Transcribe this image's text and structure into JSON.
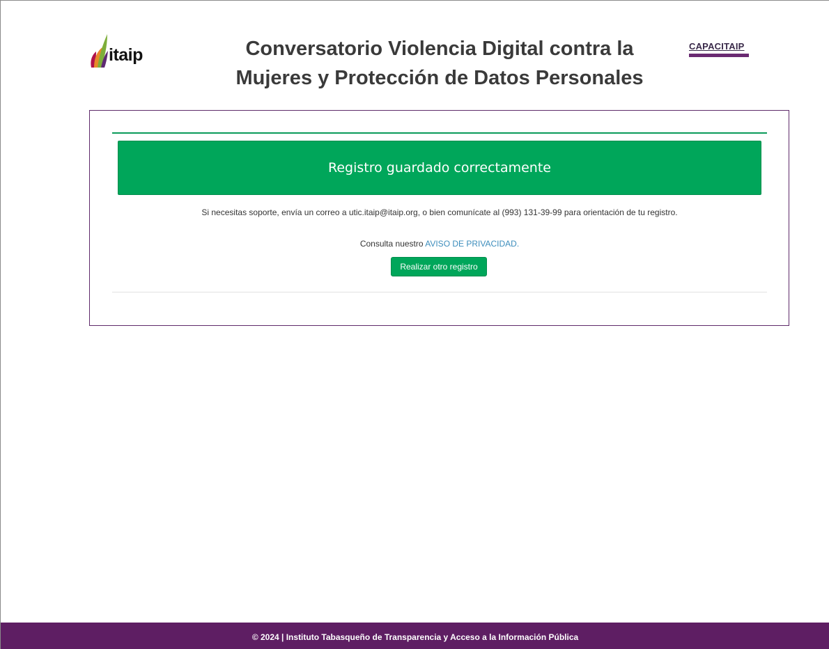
{
  "header": {
    "logo_left_text": "itaip",
    "title_line1": "Conversatorio Violencia Digital contra la",
    "title_line2": "Mujeres y Protección de Datos Personales",
    "logo_right_text": "CAPACITAIP"
  },
  "card": {
    "alert_message": "Registro guardado correctamente",
    "support_text": "Si necesitas soporte, envía un correo a utic.itaip@itaip.org, o bien comunícate al (993) 131-39-99 para orientación de tu registro.",
    "privacy_prefix": "Consulta nuestro",
    "privacy_link": "AVISO DE PRIVACIDAD.",
    "action_button": "Realizar otro registro"
  },
  "footer": {
    "text": "© 2024 | Instituto Tabasqueño de Transparencia y Acceso a la Información Pública"
  },
  "colors": {
    "success_green": "#00a65a",
    "brand_purple": "#5e1e63",
    "link_blue": "#3c8dbc"
  },
  "icons": {
    "left_logo": "itaip-leaf-logo",
    "right_logo": "capacitaip-logo"
  }
}
